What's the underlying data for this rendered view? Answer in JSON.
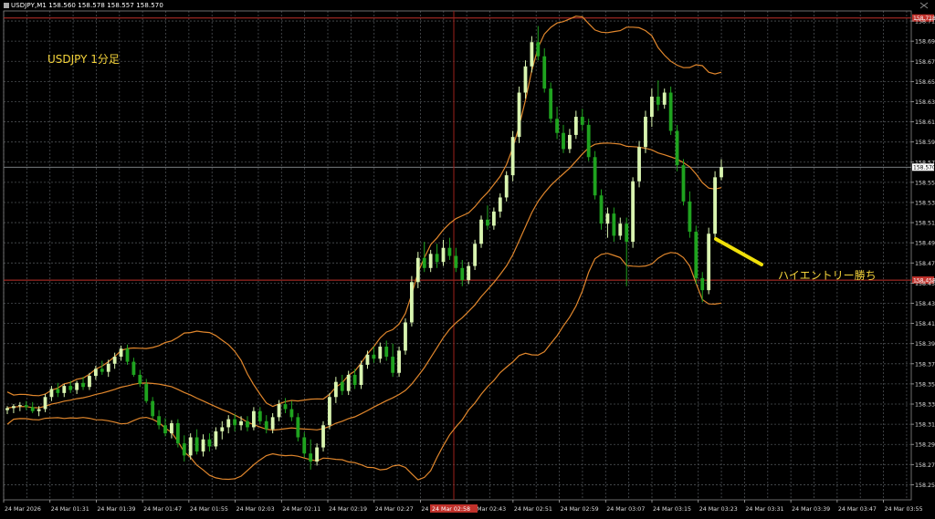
{
  "window": {
    "header": "USDJPY,M1 158.560 158.578 158.557 158.570"
  },
  "annotations": {
    "title": "USDJPY 1分足",
    "callout": "ハイエントリー勝ち"
  },
  "colors": {
    "background": "#000000",
    "grid": "#4b4f53",
    "bull_candle": "#d9f5b0",
    "bear_candle": "#1fa31f",
    "band": "#e0862c",
    "hline": "#c0312b",
    "crosshair": "#9a1f1a",
    "annotation": "#f4d33b",
    "arrow": "#f0e00a",
    "current_price_line": "#8a8f94"
  },
  "chart_data": {
    "type": "candlestick",
    "symbol": "USDJPY",
    "timeframe": "M1",
    "ylim": [
      158.24,
      158.725
    ],
    "y_ticks": [
      "158.715",
      "158.695",
      "158.675",
      "158.655",
      "158.635",
      "158.615",
      "158.595",
      "158.575",
      "158.555",
      "158.535",
      "158.515",
      "158.495",
      "158.475",
      "158.455",
      "158.435",
      "158.415",
      "158.395",
      "158.375",
      "158.355",
      "158.335",
      "158.315",
      "158.295",
      "158.275",
      "158.255"
    ],
    "x_labels": [
      "24 Mar 2026",
      "24 Mar 01:31",
      "24 Mar 01:39",
      "24 Mar 01:47",
      "24 Mar 01:55",
      "24 Mar 02:03",
      "24 Mar 02:11",
      "24 Mar 02:19",
      "24 Mar 02:27",
      "24 Mar 02:35",
      "24 Mar 02:43",
      "24 Mar 02:51",
      "24 Mar 02:59",
      "24 Mar 03:07",
      "24 Mar 03:15",
      "24 Mar 03:23",
      "24 Mar 03:31",
      "24 Mar 03:39",
      "24 Mar 03:47",
      "24 Mar 03:55"
    ],
    "current_price": 158.57,
    "current_price_label": "158.570",
    "horizontal_lines": [
      {
        "value": 158.718,
        "label": "158.718"
      },
      {
        "value": 158.458,
        "label": "158.458"
      }
    ],
    "crosshair_label": "24 Mar 02:58",
    "indicator": "Bollinger Bands",
    "candles": [
      {
        "o": 158.329,
        "h": 158.333,
        "l": 158.325,
        "c": 158.331
      },
      {
        "o": 158.331,
        "h": 158.335,
        "l": 158.326,
        "c": 158.333
      },
      {
        "o": 158.333,
        "h": 158.337,
        "l": 158.328,
        "c": 158.334
      },
      {
        "o": 158.334,
        "h": 158.338,
        "l": 158.329,
        "c": 158.332
      },
      {
        "o": 158.332,
        "h": 158.337,
        "l": 158.326,
        "c": 158.328
      },
      {
        "o": 158.328,
        "h": 158.333,
        "l": 158.323,
        "c": 158.33
      },
      {
        "o": 158.33,
        "h": 158.345,
        "l": 158.327,
        "c": 158.342
      },
      {
        "o": 158.342,
        "h": 158.353,
        "l": 158.338,
        "c": 158.35
      },
      {
        "o": 158.35,
        "h": 158.356,
        "l": 158.342,
        "c": 158.346
      },
      {
        "o": 158.346,
        "h": 158.355,
        "l": 158.342,
        "c": 158.353
      },
      {
        "o": 158.353,
        "h": 158.358,
        "l": 158.346,
        "c": 158.349
      },
      {
        "o": 158.349,
        "h": 158.358,
        "l": 158.345,
        "c": 158.356
      },
      {
        "o": 158.356,
        "h": 158.362,
        "l": 158.349,
        "c": 158.352
      },
      {
        "o": 158.352,
        "h": 158.366,
        "l": 158.349,
        "c": 158.363
      },
      {
        "o": 158.363,
        "h": 158.373,
        "l": 158.359,
        "c": 158.37
      },
      {
        "o": 158.37,
        "h": 158.378,
        "l": 158.364,
        "c": 158.367
      },
      {
        "o": 158.367,
        "h": 158.379,
        "l": 158.362,
        "c": 158.375
      },
      {
        "o": 158.375,
        "h": 158.386,
        "l": 158.37,
        "c": 158.382
      },
      {
        "o": 158.382,
        "h": 158.393,
        "l": 158.378,
        "c": 158.39
      },
      {
        "o": 158.39,
        "h": 158.394,
        "l": 158.374,
        "c": 158.377
      },
      {
        "o": 158.377,
        "h": 158.381,
        "l": 158.362,
        "c": 158.364
      },
      {
        "o": 158.364,
        "h": 158.369,
        "l": 158.352,
        "c": 158.355
      },
      {
        "o": 158.355,
        "h": 158.36,
        "l": 158.336,
        "c": 158.338
      },
      {
        "o": 158.338,
        "h": 158.342,
        "l": 158.32,
        "c": 158.323
      },
      {
        "o": 158.323,
        "h": 158.329,
        "l": 158.31,
        "c": 158.314
      },
      {
        "o": 158.314,
        "h": 158.321,
        "l": 158.303,
        "c": 158.306
      },
      {
        "o": 158.306,
        "h": 158.319,
        "l": 158.301,
        "c": 158.316
      },
      {
        "o": 158.316,
        "h": 158.32,
        "l": 158.292,
        "c": 158.296
      },
      {
        "o": 158.296,
        "h": 158.304,
        "l": 158.278,
        "c": 158.284
      },
      {
        "o": 158.284,
        "h": 158.306,
        "l": 158.28,
        "c": 158.302
      },
      {
        "o": 158.302,
        "h": 158.31,
        "l": 158.285,
        "c": 158.288
      },
      {
        "o": 158.288,
        "h": 158.305,
        "l": 158.283,
        "c": 158.3
      },
      {
        "o": 158.3,
        "h": 158.306,
        "l": 158.288,
        "c": 158.293
      },
      {
        "o": 158.293,
        "h": 158.312,
        "l": 158.29,
        "c": 158.308
      },
      {
        "o": 158.308,
        "h": 158.318,
        "l": 158.3,
        "c": 158.312
      },
      {
        "o": 158.312,
        "h": 158.324,
        "l": 158.306,
        "c": 158.32
      },
      {
        "o": 158.32,
        "h": 158.325,
        "l": 158.308,
        "c": 158.314
      },
      {
        "o": 158.314,
        "h": 158.323,
        "l": 158.309,
        "c": 158.318
      },
      {
        "o": 158.318,
        "h": 158.323,
        "l": 158.308,
        "c": 158.312
      },
      {
        "o": 158.312,
        "h": 158.332,
        "l": 158.309,
        "c": 158.328
      },
      {
        "o": 158.328,
        "h": 158.332,
        "l": 158.315,
        "c": 158.318
      },
      {
        "o": 158.318,
        "h": 158.324,
        "l": 158.306,
        "c": 158.31
      },
      {
        "o": 158.31,
        "h": 158.326,
        "l": 158.306,
        "c": 158.322
      },
      {
        "o": 158.322,
        "h": 158.339,
        "l": 158.318,
        "c": 158.335
      },
      {
        "o": 158.335,
        "h": 158.341,
        "l": 158.326,
        "c": 158.33
      },
      {
        "o": 158.33,
        "h": 158.338,
        "l": 158.318,
        "c": 158.322
      },
      {
        "o": 158.322,
        "h": 158.326,
        "l": 158.298,
        "c": 158.302
      },
      {
        "o": 158.302,
        "h": 158.307,
        "l": 158.282,
        "c": 158.286
      },
      {
        "o": 158.286,
        "h": 158.3,
        "l": 158.27,
        "c": 158.278
      },
      {
        "o": 158.278,
        "h": 158.296,
        "l": 158.274,
        "c": 158.292
      },
      {
        "o": 158.292,
        "h": 158.318,
        "l": 158.288,
        "c": 158.314
      },
      {
        "o": 158.314,
        "h": 158.346,
        "l": 158.31,
        "c": 158.342
      },
      {
        "o": 158.342,
        "h": 158.362,
        "l": 158.336,
        "c": 158.357
      },
      {
        "o": 158.357,
        "h": 158.364,
        "l": 158.344,
        "c": 158.348
      },
      {
        "o": 158.348,
        "h": 158.368,
        "l": 158.344,
        "c": 158.364
      },
      {
        "o": 158.364,
        "h": 158.37,
        "l": 158.35,
        "c": 158.354
      },
      {
        "o": 158.354,
        "h": 158.378,
        "l": 158.35,
        "c": 158.374
      },
      {
        "o": 158.374,
        "h": 158.388,
        "l": 158.37,
        "c": 158.384
      },
      {
        "o": 158.384,
        "h": 158.392,
        "l": 158.376,
        "c": 158.38
      },
      {
        "o": 158.38,
        "h": 158.396,
        "l": 158.376,
        "c": 158.392
      },
      {
        "o": 158.392,
        "h": 158.398,
        "l": 158.378,
        "c": 158.382
      },
      {
        "o": 158.382,
        "h": 158.395,
        "l": 158.362,
        "c": 158.366
      },
      {
        "o": 158.366,
        "h": 158.392,
        "l": 158.362,
        "c": 158.388
      },
      {
        "o": 158.388,
        "h": 158.42,
        "l": 158.384,
        "c": 158.416
      },
      {
        "o": 158.416,
        "h": 158.462,
        "l": 158.412,
        "c": 158.456
      },
      {
        "o": 158.456,
        "h": 158.486,
        "l": 158.45,
        "c": 158.48
      },
      {
        "o": 158.48,
        "h": 158.496,
        "l": 158.466,
        "c": 158.47
      },
      {
        "o": 158.47,
        "h": 158.488,
        "l": 158.466,
        "c": 158.484
      },
      {
        "o": 158.484,
        "h": 158.494,
        "l": 158.47,
        "c": 158.476
      },
      {
        "o": 158.476,
        "h": 158.498,
        "l": 158.472,
        "c": 158.49
      },
      {
        "o": 158.49,
        "h": 158.5,
        "l": 158.478,
        "c": 158.482
      },
      {
        "o": 158.482,
        "h": 158.49,
        "l": 158.466,
        "c": 158.47
      },
      {
        "o": 158.47,
        "h": 158.478,
        "l": 158.452,
        "c": 158.458
      },
      {
        "o": 158.458,
        "h": 158.476,
        "l": 158.454,
        "c": 158.472
      },
      {
        "o": 158.472,
        "h": 158.498,
        "l": 158.468,
        "c": 158.494
      },
      {
        "o": 158.494,
        "h": 158.522,
        "l": 158.49,
        "c": 158.518
      },
      {
        "o": 158.518,
        "h": 158.532,
        "l": 158.508,
        "c": 158.512
      },
      {
        "o": 158.512,
        "h": 158.53,
        "l": 158.508,
        "c": 158.526
      },
      {
        "o": 158.526,
        "h": 158.544,
        "l": 158.52,
        "c": 158.54
      },
      {
        "o": 158.54,
        "h": 158.566,
        "l": 158.536,
        "c": 158.562
      },
      {
        "o": 158.562,
        "h": 158.606,
        "l": 158.556,
        "c": 158.6
      },
      {
        "o": 158.6,
        "h": 158.65,
        "l": 158.594,
        "c": 158.644
      },
      {
        "o": 158.644,
        "h": 158.676,
        "l": 158.638,
        "c": 158.67
      },
      {
        "o": 158.67,
        "h": 158.7,
        "l": 158.664,
        "c": 158.694
      },
      {
        "o": 158.694,
        "h": 158.71,
        "l": 158.676,
        "c": 158.68
      },
      {
        "o": 158.68,
        "h": 158.688,
        "l": 158.644,
        "c": 158.648
      },
      {
        "o": 158.648,
        "h": 158.654,
        "l": 158.614,
        "c": 158.618
      },
      {
        "o": 158.618,
        "h": 158.63,
        "l": 158.598,
        "c": 158.604
      },
      {
        "o": 158.604,
        "h": 158.612,
        "l": 158.584,
        "c": 158.588
      },
      {
        "o": 158.588,
        "h": 158.608,
        "l": 158.584,
        "c": 158.602
      },
      {
        "o": 158.602,
        "h": 158.626,
        "l": 158.598,
        "c": 158.62
      },
      {
        "o": 158.62,
        "h": 158.628,
        "l": 158.606,
        "c": 158.612
      },
      {
        "o": 158.612,
        "h": 158.618,
        "l": 158.576,
        "c": 158.58
      },
      {
        "o": 158.58,
        "h": 158.586,
        "l": 158.538,
        "c": 158.542
      },
      {
        "o": 158.542,
        "h": 158.548,
        "l": 158.508,
        "c": 158.514
      },
      {
        "o": 158.514,
        "h": 158.53,
        "l": 158.5,
        "c": 158.524
      },
      {
        "o": 158.524,
        "h": 158.53,
        "l": 158.496,
        "c": 158.502
      },
      {
        "o": 158.502,
        "h": 158.52,
        "l": 158.498,
        "c": 158.514
      },
      {
        "o": 158.514,
        "h": 158.52,
        "l": 158.452,
        "c": 158.496
      },
      {
        "o": 158.496,
        "h": 158.56,
        "l": 158.49,
        "c": 158.556
      },
      {
        "o": 158.556,
        "h": 158.596,
        "l": 158.55,
        "c": 158.59
      },
      {
        "o": 158.59,
        "h": 158.626,
        "l": 158.584,
        "c": 158.62
      },
      {
        "o": 158.62,
        "h": 158.648,
        "l": 158.61,
        "c": 158.64
      },
      {
        "o": 158.64,
        "h": 158.656,
        "l": 158.626,
        "c": 158.632
      },
      {
        "o": 158.632,
        "h": 158.648,
        "l": 158.628,
        "c": 158.644
      },
      {
        "o": 158.644,
        "h": 158.65,
        "l": 158.602,
        "c": 158.606
      },
      {
        "o": 158.606,
        "h": 158.612,
        "l": 158.566,
        "c": 158.572
      },
      {
        "o": 158.572,
        "h": 158.578,
        "l": 158.532,
        "c": 158.536
      },
      {
        "o": 158.536,
        "h": 158.546,
        "l": 158.5,
        "c": 158.506
      },
      {
        "o": 158.506,
        "h": 158.512,
        "l": 158.454,
        "c": 158.46
      },
      {
        "o": 158.46,
        "h": 158.466,
        "l": 158.436,
        "c": 158.448
      },
      {
        "o": 158.448,
        "h": 158.51,
        "l": 158.444,
        "c": 158.504
      },
      {
        "o": 158.504,
        "h": 158.566,
        "l": 158.498,
        "c": 158.56
      },
      {
        "o": 158.56,
        "h": 158.578,
        "l": 158.557,
        "c": 158.57
      }
    ]
  }
}
